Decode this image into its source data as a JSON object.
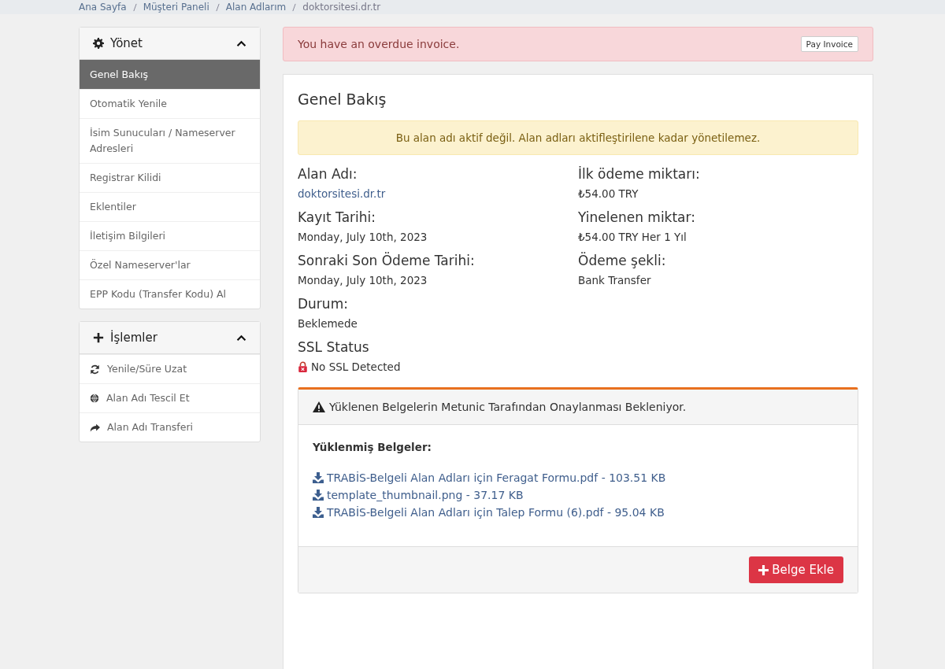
{
  "breadcrumb": [
    "Ana Sayfa",
    "Müşteri Paneli",
    "Alan Adlarım",
    "doktorsitesi.dr.tr"
  ],
  "sidebar": [
    {
      "title": "Yönet",
      "expanded": true,
      "items": [
        {
          "label": "Genel Bakış",
          "selected": true
        },
        {
          "label": "Otomatik Yenile",
          "selected": false
        },
        {
          "label": "İsim Sunucuları / Nameserver Adresleri",
          "selected": false
        },
        {
          "label": "Registrar Kilidi",
          "selected": false
        },
        {
          "label": "Eklentiler",
          "selected": false
        },
        {
          "label": "İletişim Bilgileri",
          "selected": false
        },
        {
          "label": "Özel Nameserver'lar",
          "selected": false
        },
        {
          "label": "EPP Kodu (Transfer Kodu) Al",
          "selected": false
        }
      ]
    },
    {
      "title": "İşlemler",
      "expanded": true,
      "items": [
        {
          "label": "Yenile/Süre Uzat",
          "selected": false
        },
        {
          "label": "Alan Adı Tescil Et",
          "selected": false
        },
        {
          "label": "Alan Adı Transferi",
          "selected": false
        }
      ]
    }
  ],
  "alert": {
    "text": "You have an overdue invoice.",
    "button": "Pay Invoice"
  },
  "overview": {
    "title": "Genel Bakış",
    "warning": "Bu alan adı aktif değil. Alan adları aktifleştirilene kadar yönetilemez.",
    "left": [
      {
        "label": "Alan Adı:",
        "value": "doktorsitesi.dr.tr",
        "kind": "link"
      },
      {
        "label": "Kayıt Tarihi:",
        "value": "Monday, July 10th, 2023",
        "kind": "text"
      },
      {
        "label": "Sonraki Son Ödeme Tarihi:",
        "value": "Monday, July 10th, 2023",
        "kind": "text"
      },
      {
        "label": "Durum:",
        "value": "Beklemede",
        "kind": "text"
      },
      {
        "label": "SSL Status",
        "value": "No SSL Detected",
        "kind": "ssl"
      }
    ],
    "right": [
      {
        "label": "İlk ödeme miktarı:",
        "value": "₺54.00 TRY",
        "kind": "text"
      },
      {
        "label": "Yinelenen miktar:",
        "value": "₺54.00 TRY Her 1 Yıl",
        "kind": "text"
      },
      {
        "label": "Ödeme şekli:",
        "value": "Bank Transfer",
        "kind": "text"
      }
    ]
  },
  "documents": {
    "notice": "Yüklenen Belgelerin Metunic Tarafından Onaylanması Bekleniyor.",
    "heading": "Yüklenmiş Belgeler:",
    "files": [
      "TRABİS-Belgeli Alan Adları için Feragat Formu.pdf - 103.51 KB",
      "template_thumbnail.png - 37.17 KB",
      "TRABİS-Belgeli Alan Adları için Talep Formu (6).pdf - 95.04 KB"
    ],
    "button": "Belge Ekle"
  }
}
